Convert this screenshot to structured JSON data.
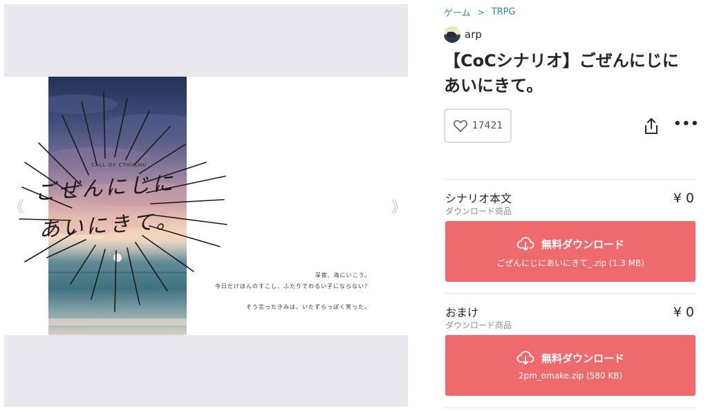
{
  "breadcrumb": {
    "category": "ゲーム",
    "subcategory": "TRPG"
  },
  "shop": {
    "name": "arp",
    "avatar_icon": "shop-avatar-icon"
  },
  "product": {
    "title_line1": "【CoCシナリオ】ごぜんにじに",
    "title_line2": "あいにきて。"
  },
  "actions": {
    "like_count": "17421",
    "like_icon": "heart-icon",
    "share_icon": "share-icon",
    "more_label": "•••"
  },
  "viewer": {
    "prev_arrow": "《",
    "next_arrow": "》",
    "cover_subtitle": "CALL OF CTHULHU",
    "cover_title_line1": "ごぜんにじに",
    "cover_title_line2": "あいにきて。",
    "caption_line1": "深夜、海にいこう。",
    "caption_line2": "今日だけほんのすこし、ふたりでわるい子にならない？",
    "caption_line3": "そう言ったきみは、いたずらっぽく笑った。"
  },
  "items": [
    {
      "name": "シナリオ本文",
      "type": "ダウンロード商品",
      "price": "¥ 0",
      "button_label": "無料ダウンロード",
      "file": "ごぜんにじにあいにきて_.zip (1.3 MB)"
    },
    {
      "name": "おまけ",
      "type": "ダウンロード商品",
      "price": "¥ 0",
      "button_label": "無料ダウンロード",
      "file": "2pm_omake.zip (580 KB)"
    }
  ],
  "colors": {
    "accent_link": "#2a8fa3",
    "download_button": "#ee6a6c",
    "viewer_bg": "#e8e8ee"
  }
}
